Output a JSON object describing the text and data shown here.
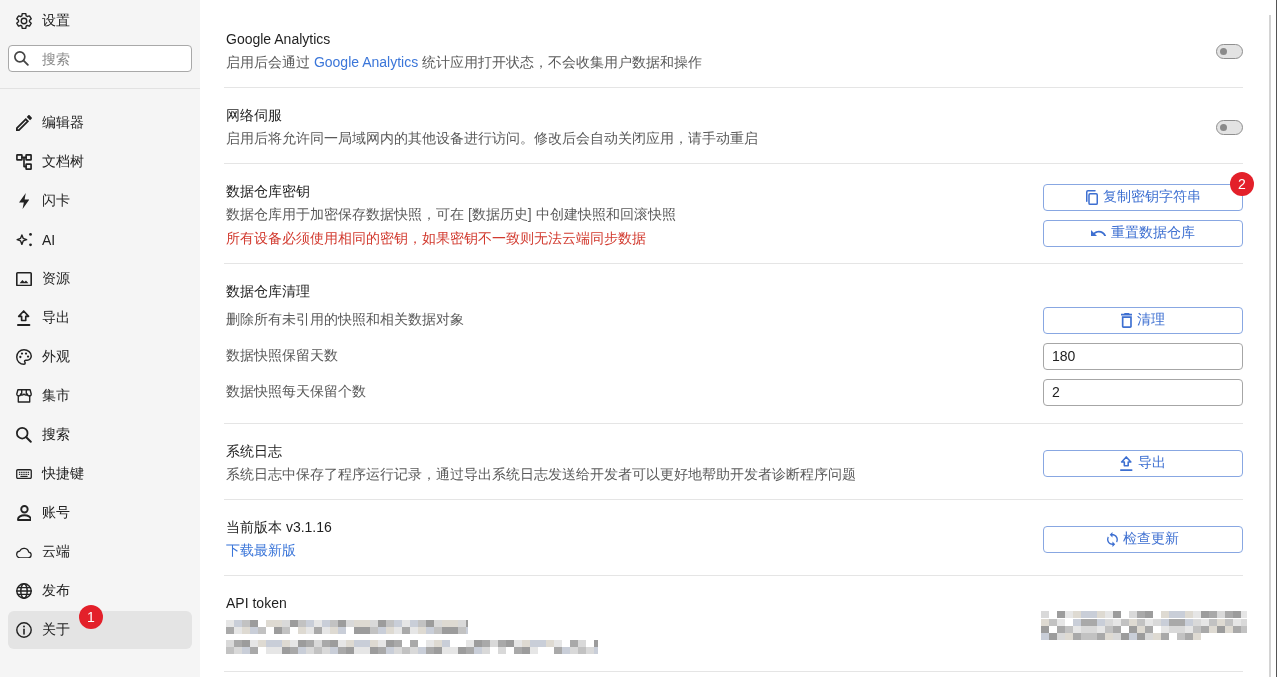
{
  "sidebar": {
    "title": "设置",
    "search": {
      "placeholder": "搜索"
    },
    "items": [
      {
        "label": "编辑器",
        "selected": false
      },
      {
        "label": "文档树",
        "selected": false
      },
      {
        "label": "闪卡",
        "selected": false
      },
      {
        "label": "AI",
        "selected": false
      },
      {
        "label": "资源",
        "selected": false
      },
      {
        "label": "导出",
        "selected": false
      },
      {
        "label": "外观",
        "selected": false
      },
      {
        "label": "集市",
        "selected": false
      },
      {
        "label": "搜索",
        "selected": false
      },
      {
        "label": "快捷键",
        "selected": false
      },
      {
        "label": "账号",
        "selected": false
      },
      {
        "label": "云端",
        "selected": false
      },
      {
        "label": "发布",
        "selected": false
      },
      {
        "label": "关于",
        "selected": true,
        "badge": "1"
      }
    ]
  },
  "sections": [
    {
      "title": "Google Analytics",
      "lines": [
        {
          "kind": "text-with-link",
          "before": "启用后会通过 ",
          "link": "Google Analytics",
          "after": " 统计应用打开状态，不会收集用户数据和操作"
        }
      ],
      "controls": [
        {
          "kind": "switch",
          "on": false
        }
      ]
    },
    {
      "title": "网络伺服",
      "lines": [
        {
          "kind": "text",
          "text": "启用后将允许同一局域网内的其他设备进行访问。修改后会自动关闭应用，请手动重启"
        }
      ],
      "controls": [
        {
          "kind": "switch",
          "on": false
        }
      ]
    },
    {
      "title": "数据仓库密钥",
      "lines": [
        {
          "kind": "text",
          "text": "数据仓库用于加密保存数据快照，可在 [数据历史] 中创建快照和回滚快照"
        },
        {
          "kind": "warning",
          "text": "所有设备必须使用相同的密钥，如果密钥不一致则无法云端同步数据"
        }
      ],
      "controls": [
        {
          "kind": "button",
          "label": "复制密钥字符串",
          "badge": "2"
        },
        {
          "kind": "button",
          "label": "重置数据仓库"
        }
      ]
    },
    {
      "title": "数据仓库清理",
      "rows": [
        {
          "label": "删除所有未引用的快照和相关数据对象",
          "control": {
            "kind": "button",
            "label": "清理"
          }
        },
        {
          "label": "数据快照保留天数",
          "control": {
            "kind": "input",
            "value": "180"
          }
        },
        {
          "label": "数据快照每天保留个数",
          "control": {
            "kind": "input",
            "value": "2"
          }
        }
      ]
    },
    {
      "title": "系统日志",
      "lines": [
        {
          "kind": "text",
          "text": "系统日志中保存了程序运行记录，通过导出系统日志发送给开发者可以更好地帮助开发者诊断程序问题"
        }
      ],
      "controls": [
        {
          "kind": "button",
          "label": "导出"
        }
      ]
    },
    {
      "title": "当前版本 v3.1.16",
      "lines": [
        {
          "kind": "link",
          "text": "下载最新版"
        }
      ],
      "controls": [
        {
          "kind": "button",
          "label": "检查更新"
        }
      ]
    },
    {
      "title": "API token",
      "masked": true
    }
  ]
}
